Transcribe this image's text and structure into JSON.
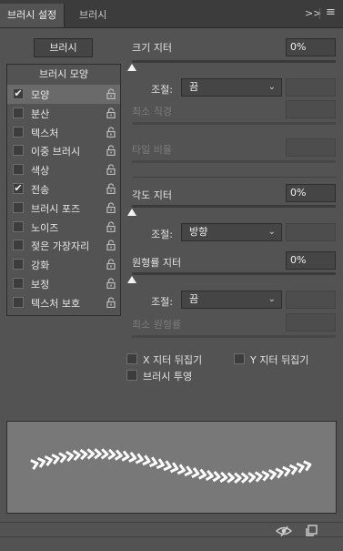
{
  "tabs": [
    {
      "label": "브러시 설정",
      "active": true
    },
    {
      "label": "브러시",
      "active": false
    }
  ],
  "tab_controls": {
    "collapse": ">>",
    "menu": "≡"
  },
  "brush_button": "브러시",
  "list": {
    "header": "브러시 모양",
    "items": [
      {
        "label": "모양",
        "checked": true,
        "selected": true
      },
      {
        "label": "분산",
        "checked": false
      },
      {
        "label": "텍스처",
        "checked": false
      },
      {
        "label": "이중 브러시",
        "checked": false
      },
      {
        "label": "색상",
        "checked": false
      },
      {
        "label": "전송",
        "checked": true
      },
      {
        "label": "브러시 포즈",
        "checked": false
      },
      {
        "label": "노이즈",
        "checked": false
      },
      {
        "label": "젖은 가장자리",
        "checked": false
      },
      {
        "label": "강화",
        "checked": false
      },
      {
        "label": "보정",
        "checked": false
      },
      {
        "label": "텍스처 보호",
        "checked": false
      }
    ]
  },
  "size_jitter": {
    "label": "크기 지터",
    "value": "0%",
    "control_label": "조절:",
    "control_value": "끔",
    "min_diameter_label": "최소 직경",
    "tilt_scale_label": "타일 비율"
  },
  "angle_jitter": {
    "label": "각도 지터",
    "value": "0%",
    "control_label": "조절:",
    "control_value": "방향"
  },
  "roundness_jitter": {
    "label": "원형률 지터",
    "value": "0%",
    "control_label": "조절:",
    "control_value": "끔",
    "min_roundness_label": "최소 원형률"
  },
  "checkboxes": {
    "flip_x": "X 지터 뒤집기",
    "flip_y": "Y 지터 뒤집기",
    "brush_projection": "브러시 투영"
  },
  "colors": {
    "panel": "#535353",
    "tabbar": "#3c3c3c",
    "preview_bg": "#787878",
    "stroke": "#ffffff"
  },
  "footer_icons": [
    "eye-icon",
    "new-brush-icon"
  ]
}
